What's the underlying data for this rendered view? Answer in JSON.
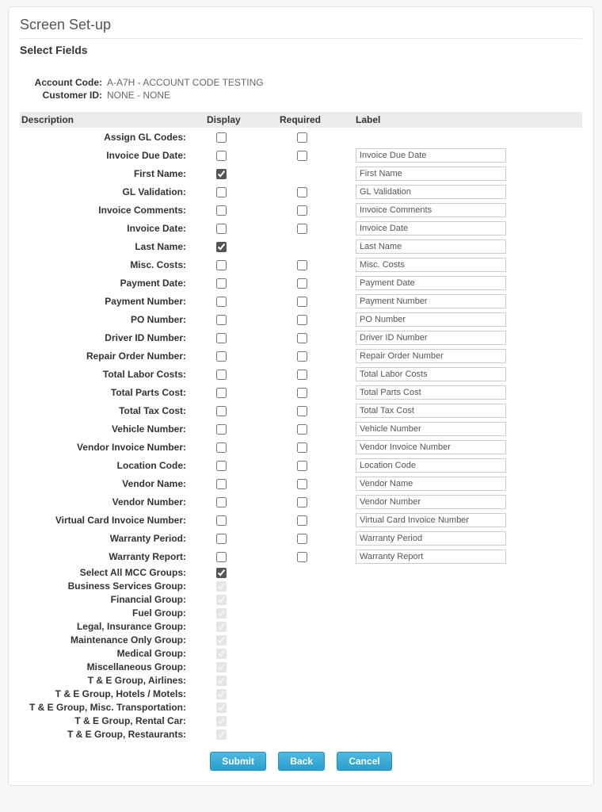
{
  "page_title": "Screen Set-up",
  "section_title": "Select Fields",
  "meta": {
    "account_code_label": "Account Code:",
    "account_code_value": "A-A7H - ACCOUNT CODE TESTING",
    "customer_id_label": "Customer ID:",
    "customer_id_value": "NONE - NONE"
  },
  "columns": {
    "description": "Description",
    "display": "Display",
    "required": "Required",
    "label": "Label"
  },
  "fields": [
    {
      "desc": "Assign GL Codes:",
      "display_checked": false,
      "has_required": true,
      "required_checked": false,
      "has_label": false,
      "label_value": ""
    },
    {
      "desc": "Invoice Due Date:",
      "display_checked": false,
      "has_required": true,
      "required_checked": false,
      "has_label": true,
      "label_value": "Invoice Due Date"
    },
    {
      "desc": "First Name:",
      "display_checked": true,
      "has_required": false,
      "required_checked": false,
      "has_label": true,
      "label_value": "First Name"
    },
    {
      "desc": "GL Validation:",
      "display_checked": false,
      "has_required": true,
      "required_checked": false,
      "has_label": true,
      "label_value": "GL Validation"
    },
    {
      "desc": "Invoice Comments:",
      "display_checked": false,
      "has_required": true,
      "required_checked": false,
      "has_label": true,
      "label_value": "Invoice Comments"
    },
    {
      "desc": "Invoice Date:",
      "display_checked": false,
      "has_required": true,
      "required_checked": false,
      "has_label": true,
      "label_value": "Invoice Date"
    },
    {
      "desc": "Last Name:",
      "display_checked": true,
      "has_required": false,
      "required_checked": false,
      "has_label": true,
      "label_value": "Last Name"
    },
    {
      "desc": "Misc. Costs:",
      "display_checked": false,
      "has_required": true,
      "required_checked": false,
      "has_label": true,
      "label_value": "Misc. Costs"
    },
    {
      "desc": "Payment Date:",
      "display_checked": false,
      "has_required": true,
      "required_checked": false,
      "has_label": true,
      "label_value": "Payment Date"
    },
    {
      "desc": "Payment Number:",
      "display_checked": false,
      "has_required": true,
      "required_checked": false,
      "has_label": true,
      "label_value": "Payment Number"
    },
    {
      "desc": "PO Number:",
      "display_checked": false,
      "has_required": true,
      "required_checked": false,
      "has_label": true,
      "label_value": "PO Number"
    },
    {
      "desc": "Driver ID Number:",
      "display_checked": false,
      "has_required": true,
      "required_checked": false,
      "has_label": true,
      "label_value": "Driver ID Number"
    },
    {
      "desc": "Repair Order Number:",
      "display_checked": false,
      "has_required": true,
      "required_checked": false,
      "has_label": true,
      "label_value": "Repair Order Number"
    },
    {
      "desc": "Total Labor Costs:",
      "display_checked": false,
      "has_required": true,
      "required_checked": false,
      "has_label": true,
      "label_value": "Total Labor Costs"
    },
    {
      "desc": "Total Parts Cost:",
      "display_checked": false,
      "has_required": true,
      "required_checked": false,
      "has_label": true,
      "label_value": "Total Parts Cost"
    },
    {
      "desc": "Total Tax Cost:",
      "display_checked": false,
      "has_required": true,
      "required_checked": false,
      "has_label": true,
      "label_value": "Total Tax Cost"
    },
    {
      "desc": "Vehicle Number:",
      "display_checked": false,
      "has_required": true,
      "required_checked": false,
      "has_label": true,
      "label_value": "Vehicle Number"
    },
    {
      "desc": "Vendor Invoice Number:",
      "display_checked": false,
      "has_required": true,
      "required_checked": false,
      "has_label": true,
      "label_value": "Vendor Invoice Number"
    },
    {
      "desc": "Location Code:",
      "display_checked": false,
      "has_required": true,
      "required_checked": false,
      "has_label": true,
      "label_value": "Location Code"
    },
    {
      "desc": "Vendor Name:",
      "display_checked": false,
      "has_required": true,
      "required_checked": false,
      "has_label": true,
      "label_value": "Vendor Name"
    },
    {
      "desc": "Vendor Number:",
      "display_checked": false,
      "has_required": true,
      "required_checked": false,
      "has_label": true,
      "label_value": "Vendor Number"
    },
    {
      "desc": "Virtual Card Invoice Number:",
      "display_checked": false,
      "has_required": true,
      "required_checked": false,
      "has_label": true,
      "label_value": "Virtual Card Invoice Number"
    },
    {
      "desc": "Warranty Period:",
      "display_checked": false,
      "has_required": true,
      "required_checked": false,
      "has_label": true,
      "label_value": "Warranty Period"
    },
    {
      "desc": "Warranty Report:",
      "display_checked": false,
      "has_required": true,
      "required_checked": false,
      "has_label": true,
      "label_value": "Warranty Report"
    }
  ],
  "groups": [
    {
      "desc": "Select All MCC Groups:",
      "checked": true,
      "disabled": false
    },
    {
      "desc": "Business Services Group:",
      "checked": true,
      "disabled": true
    },
    {
      "desc": "Financial Group:",
      "checked": true,
      "disabled": true
    },
    {
      "desc": "Fuel Group:",
      "checked": true,
      "disabled": true
    },
    {
      "desc": "Legal, Insurance Group:",
      "checked": true,
      "disabled": true
    },
    {
      "desc": "Maintenance Only Group:",
      "checked": true,
      "disabled": true
    },
    {
      "desc": "Medical Group:",
      "checked": true,
      "disabled": true
    },
    {
      "desc": "Miscellaneous Group:",
      "checked": true,
      "disabled": true
    },
    {
      "desc": "T & E Group, Airlines:",
      "checked": true,
      "disabled": true
    },
    {
      "desc": "T & E Group, Hotels / Motels:",
      "checked": true,
      "disabled": true
    },
    {
      "desc": "T & E Group, Misc. Transportation:",
      "checked": true,
      "disabled": true
    },
    {
      "desc": "T & E Group, Rental Car:",
      "checked": true,
      "disabled": true
    },
    {
      "desc": "T & E Group, Restaurants:",
      "checked": true,
      "disabled": true
    }
  ],
  "buttons": {
    "submit": "Submit",
    "back": "Back",
    "cancel": "Cancel"
  }
}
